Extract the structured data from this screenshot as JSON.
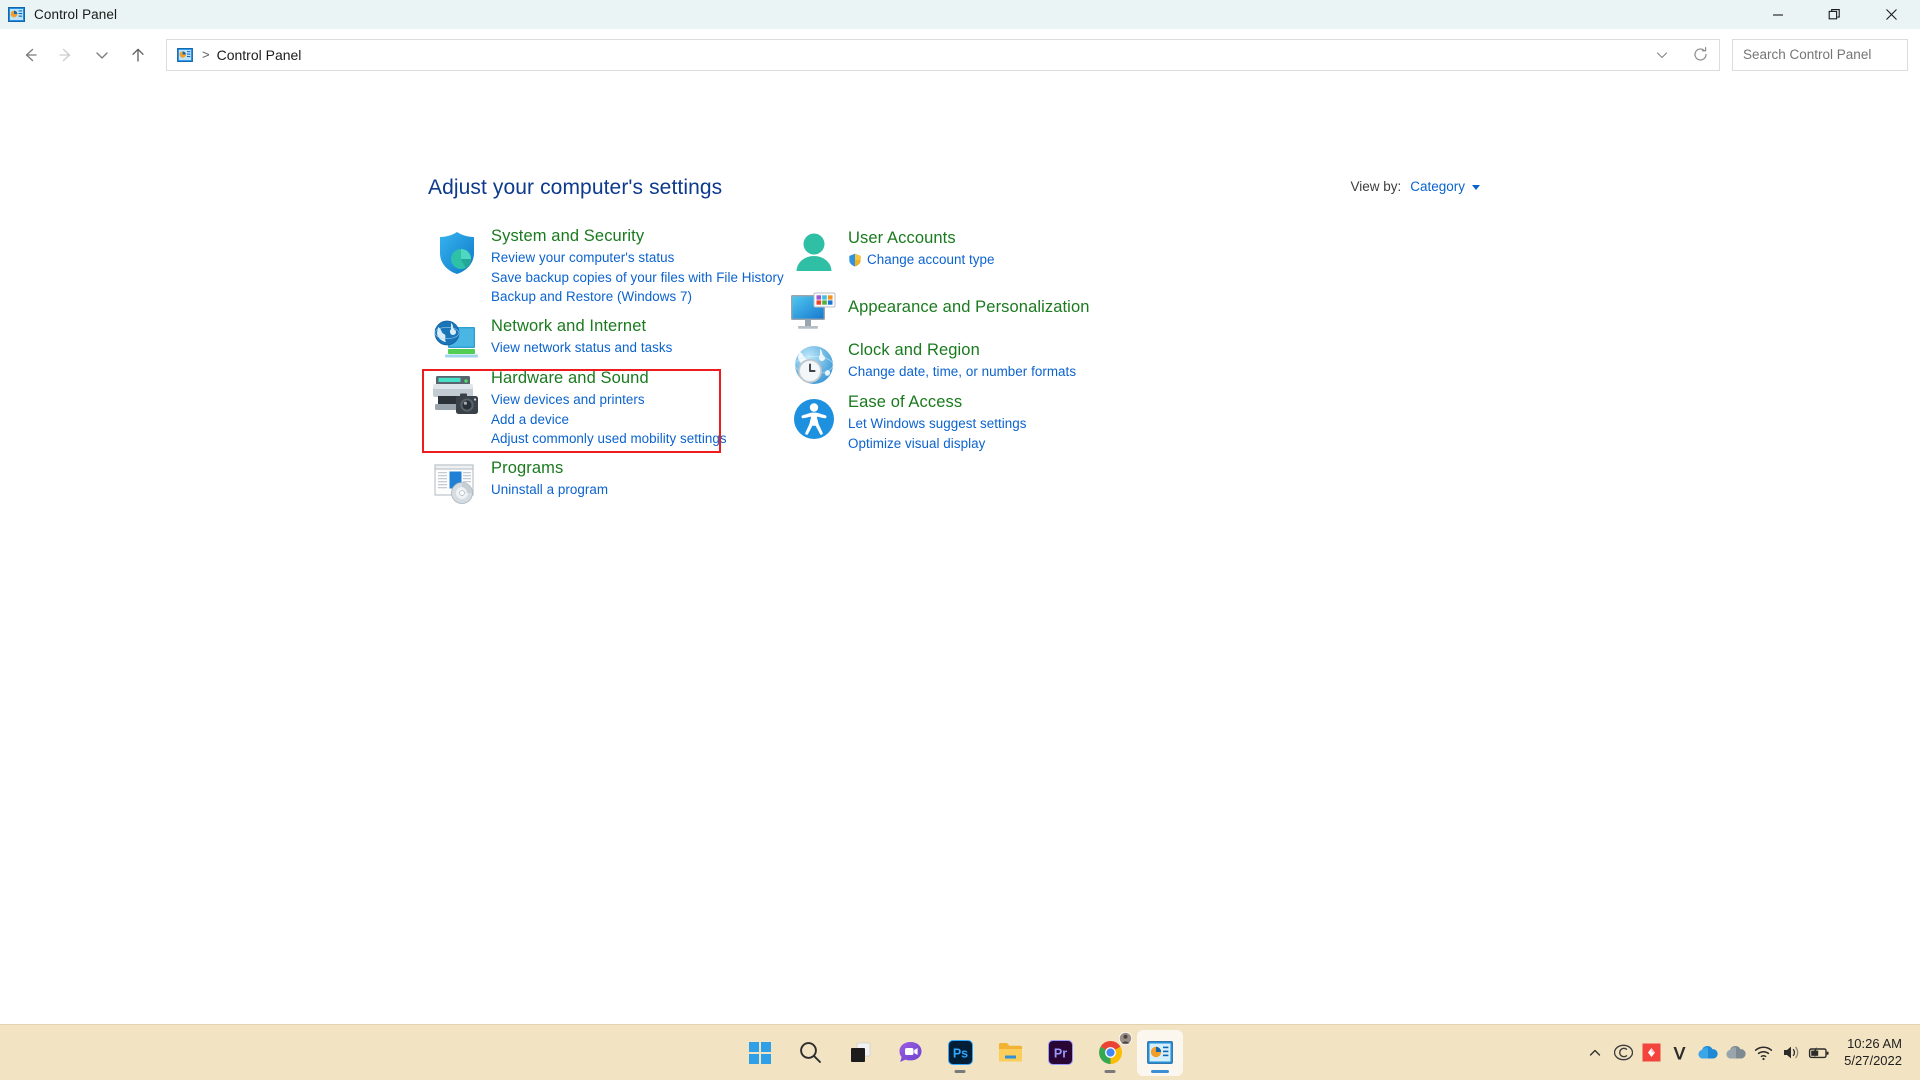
{
  "window": {
    "title": "Control Panel",
    "icon": "control-panel-icon",
    "controls": {
      "minimize": "Minimize",
      "restore": "Restore",
      "close": "Close"
    }
  },
  "nav": {
    "back": "Back",
    "forward": "Forward",
    "recent": "Recent locations",
    "up": "Up",
    "refresh": "Refresh",
    "breadcrumb_separator": ">",
    "breadcrumb": "Control Panel",
    "search_value": "",
    "search_placeholder": "Search Control Panel"
  },
  "main": {
    "heading": "Adjust your computer's settings",
    "view_by_label": "View by:",
    "view_by_value": "Category",
    "left_categories": [
      {
        "id": "system-and-security",
        "icon": "shield-icon",
        "title": "System and Security",
        "links": [
          "Review your computer's status",
          "Save backup copies of your files with File History",
          "Backup and Restore (Windows 7)"
        ]
      },
      {
        "id": "network-and-internet",
        "icon": "network-globe-icon",
        "title": "Network and Internet",
        "links": [
          "View network status and tasks"
        ]
      },
      {
        "id": "hardware-and-sound",
        "icon": "printer-camera-icon",
        "title": "Hardware and Sound",
        "links": [
          "View devices and printers",
          "Add a device",
          "Adjust commonly used mobility settings"
        ]
      },
      {
        "id": "programs",
        "icon": "programs-disc-icon",
        "title": "Programs",
        "links": [
          "Uninstall a program"
        ]
      }
    ],
    "right_categories": [
      {
        "id": "user-accounts",
        "icon": "user-person-icon",
        "title": "User Accounts",
        "links": [
          "Change account type"
        ],
        "link_shield": true
      },
      {
        "id": "appearance-and-personalization",
        "icon": "monitor-tiles-icon",
        "title": "Appearance and Personalization",
        "links": []
      },
      {
        "id": "clock-and-region",
        "icon": "globe-clock-icon",
        "title": "Clock and Region",
        "links": [
          "Change date, time, or number formats"
        ]
      },
      {
        "id": "ease-of-access",
        "icon": "accessibility-icon",
        "title": "Ease of Access",
        "links": [
          "Let Windows suggest settings",
          "Optimize visual display"
        ]
      }
    ],
    "highlight": {
      "target": "hardware-and-sound",
      "color": "#ee1c1c"
    }
  },
  "taskbar": {
    "items": [
      {
        "name": "start-button",
        "label": "Start"
      },
      {
        "name": "search-button",
        "label": "Search"
      },
      {
        "name": "task-view-button",
        "label": "Task View"
      },
      {
        "name": "chat-button",
        "label": "Chat"
      },
      {
        "name": "photoshop-button",
        "label": "Ps"
      },
      {
        "name": "file-explorer-button",
        "label": "File Explorer"
      },
      {
        "name": "premiere-pro-button",
        "label": "Pr"
      },
      {
        "name": "chrome-button",
        "label": "Google Chrome"
      },
      {
        "name": "control-panel-taskbar-button",
        "label": "Control Panel"
      }
    ],
    "tray": [
      {
        "name": "show-hidden-icons-button",
        "label": "Show hidden icons"
      },
      {
        "name": "creative-cloud-icon",
        "label": "Creative Cloud"
      },
      {
        "name": "red-app-icon",
        "label": "App"
      },
      {
        "name": "v-app-icon",
        "label": "V"
      },
      {
        "name": "onedrive-personal-icon",
        "label": "OneDrive"
      },
      {
        "name": "onedrive-work-icon",
        "label": "OneDrive"
      },
      {
        "name": "wifi-icon",
        "label": "Network"
      },
      {
        "name": "volume-icon",
        "label": "Volume"
      },
      {
        "name": "battery-icon",
        "label": "Battery"
      }
    ],
    "clock": {
      "time": "10:26 AM",
      "date": "5/27/2022"
    }
  },
  "colors": {
    "title_green": "#1a7a1e",
    "link_blue": "#0b63ce",
    "heading_blue": "#0d3a8c",
    "highlight_red": "#ee1c1c",
    "titlebar_bg": "#eaf4f4",
    "taskbar_bg": "#f2e3c3"
  }
}
